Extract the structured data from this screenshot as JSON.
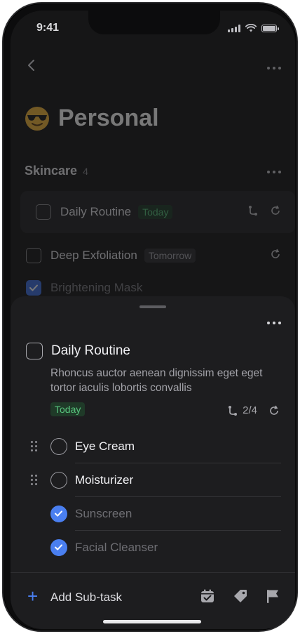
{
  "status": {
    "time": "9:41"
  },
  "background": {
    "page_title": "Personal",
    "section": {
      "title": "Skincare",
      "count": "4"
    },
    "rows": [
      {
        "label": "Daily Routine",
        "tag": "Today",
        "checked": false
      },
      {
        "label": "Deep Exfoliation",
        "tag": "Tomorrow",
        "checked": false
      },
      {
        "label": "Brightening Mask",
        "tag": "",
        "checked": true
      }
    ]
  },
  "sheet": {
    "title": "Daily Routine",
    "description": "Rhoncus auctor aenean dignissim eget eget tortor iaculis lobortis convallis",
    "tag": "Today",
    "subtask_progress": "2/4",
    "subtasks": [
      {
        "label": "Eye Cream",
        "done": false
      },
      {
        "label": "Moisturizer",
        "done": false
      },
      {
        "label": "Sunscreen",
        "done": true
      },
      {
        "label": "Facial Cleanser",
        "done": true
      }
    ],
    "add_label": "Add Sub-task"
  },
  "colors": {
    "accent": "#4a7ff0",
    "today_green": "#57c27c",
    "background": "#161617",
    "sheet": "#1d1d1f"
  },
  "icons": [
    "back-chevron-icon",
    "more-icon",
    "subtask-branch-icon",
    "repeat-icon",
    "calendar-check-icon",
    "tag-icon",
    "flag-icon",
    "plus-icon",
    "drag-handle-icon",
    "check-icon"
  ]
}
